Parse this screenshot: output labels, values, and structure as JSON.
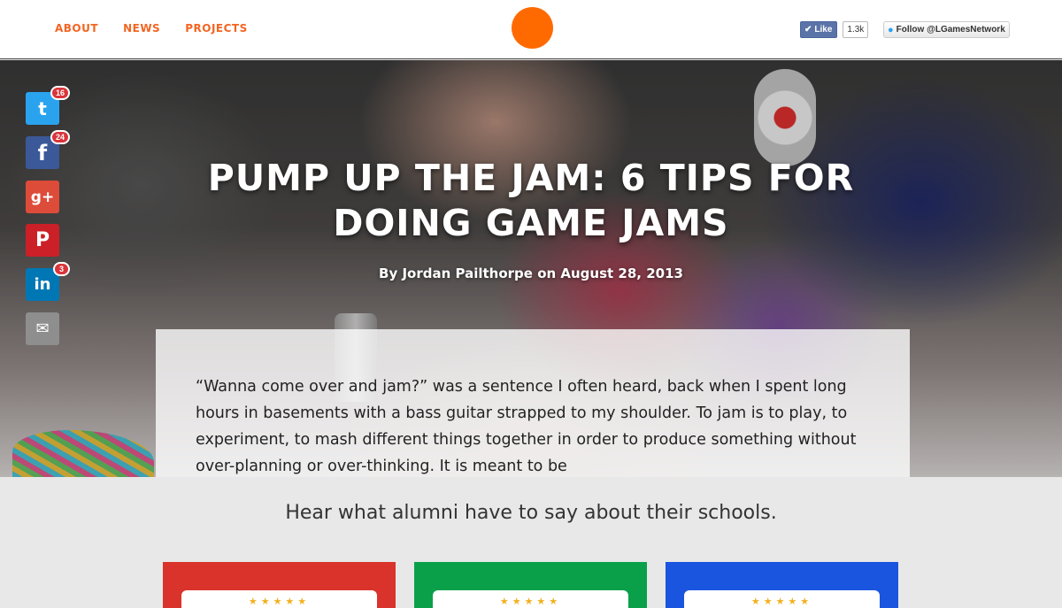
{
  "header": {
    "nav": [
      "ABOUT",
      "NEWS",
      "PROJECTS"
    ],
    "fb_like_label": "Like",
    "fb_like_count": "1.3k",
    "twitter_follow_label": "Follow @LGamesNetwork"
  },
  "hero": {
    "title": "PUMP UP THE JAM: 6 TIPS FOR DOING GAME JAMS",
    "byline": "By Jordan Pailthorpe on August 28, 2013"
  },
  "article": {
    "text": "“Wanna come over and jam?” was a sentence I often heard, back when I spent long hours in basements with a bass guitar strapped to my shoulder. To jam is to play, to experiment, to mash different things together in order to produce something without over-planning or over-thinking. It is meant to be"
  },
  "social": {
    "twitter": {
      "glyph": "t",
      "count": "16"
    },
    "facebook": {
      "glyph": "f",
      "count": "24"
    },
    "googleplus": {
      "glyph": "g+"
    },
    "pinterest": {
      "glyph": "P"
    },
    "linkedin": {
      "glyph": "in",
      "count": "3"
    },
    "email": {
      "glyph": "✉"
    }
  },
  "bottom": {
    "tagline": "Hear what alumni have to say about their schools.",
    "card_stars": "★★★★★"
  },
  "colors": {
    "accent": "#f26522",
    "logo": "#ff6a00",
    "card_red": "#d9332b",
    "card_green": "#0aa04a",
    "card_blue": "#1a55e0"
  }
}
